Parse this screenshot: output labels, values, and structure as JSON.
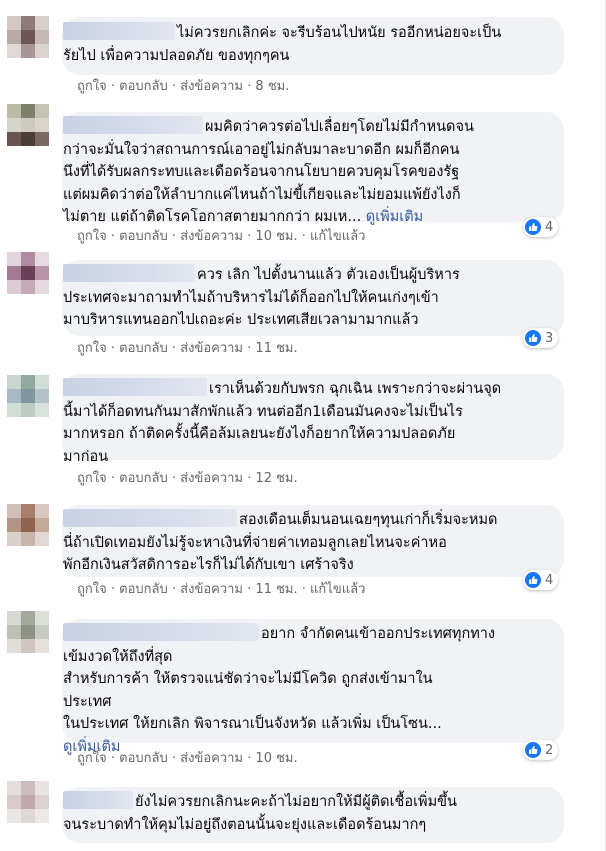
{
  "actions": {
    "like": "ถูกใจ",
    "reply": "ตอบกลับ",
    "share": "ส่งข้อความ",
    "dot": "·",
    "edited": "แก้ไขแล้ว"
  },
  "comments": [
    {
      "lines": [
        "ไม่ควรยกเลิกค่ะ จะรีบร้อนไปหนัย รออีกหน่อยจะเป็น",
        "รัยไป เพื่อความปลอดภัย ของทุกๆคน"
      ],
      "time": "8 ชม."
    },
    {
      "lines": [
        "ผมคิดว่าควรต่อไปเลื่อยๆโดยไม่มีกำหนดจน",
        "กว่าจะมั่นใจว่าสถานการณ์เอาอยู่ไม่กลับมาละบาดอีก ผมก็อีกคน",
        "นึงที่ได้รับผลกระทบและเดือดร้อนจากนโยบายควบคุมโรคของรัฐ",
        "แต่ผมคิดว่าต่อให้ลำบากแค่ไหนถ้าไม่ขี้เกียจและไม่ยอมแพ้ยังไงก็",
        "ไม่ตาย แต่ถ้าติดโรคโอกาสตายมากกว่า ผมเห..."
      ],
      "see_more": "ดูเพิ่มเติม",
      "time": "10 ชม.",
      "reactions": "4"
    },
    {
      "lines": [
        "ควร เลิก ไปตั้งนานแล้ว ตัวเองเป็นผู้บริหาร",
        "ประเทศจะมาถามทำไมถ้าบริหารไม่ได้ก็ออกไปให้คนเก่งๆเข้า",
        "มาบริหารแทนออกไปเถอะค่ะ ประเทศเสียเวลามามากแล้ว"
      ],
      "time": "11 ชม.",
      "reactions": "3"
    },
    {
      "lines": [
        "เราเห็นด้วยกับพรก ฉุกเฉิน เพราะกว่าจะผ่านจุด",
        "นี้มาได้ก็อดทนกันมาสักพักแล้ว ทนต่ออีก1เดือนมันคงจะไม่เป็นไร",
        "มากหรอก ถ้าติดครั้งนี้คือล้มเลยนะยังไงก็อยากให้ความปลอดภัย",
        "มาก่อน"
      ],
      "time": "12 ชม."
    },
    {
      "lines": [
        "สองเดือนเต็มนอนเฉยๆทุนเก่าก็เริ่มจะหมด",
        "นี่ถ้าเปิดเทอมยังไม่รู้จะหาเงินที่จ่ายค่าเทอมลูกเลยไหนจะค่าหอ",
        "พักอีกเงินสวัสดิการอะไรก็ไม่ได้กับเขา เศร้าจริง"
      ],
      "time": "11 ชม.",
      "reactions": "4"
    },
    {
      "lines": [
        "อยาก จำกัดคนเข้าออกประเทศทุกทาง",
        "เข้มงวดให้ถึงที่สุด",
        "สำหรับการค้า ให้ตรวจแน่ชัดว่าจะไม่มีโควิด ถูกส่งเข้ามาใน",
        "ประเทศ",
        "ในประเทศ ให้ยกเลิก พิจารณาเป็นจังหวัด แล้วเพิ่ม เป็นโซน..."
      ],
      "see_more": "ดูเพิ่มเติม",
      "time": "10 ชม.",
      "reactions": "2"
    },
    {
      "lines": [
        "ยังไม่ควรยกเลิกนะคะถ้าไม่อยากให้มีผู้ติดเชื้อเพิ่มขึ้น",
        "จนระบาดทำให้คุมไม่อยู่ถึงตอนนั้นจะยุ่งและเดือดร้อนมากๆ"
      ]
    }
  ],
  "colors": {
    "link": "#385898",
    "meta": "#65676b",
    "bubble": "#f0f2f5",
    "like": "#1877f2"
  }
}
